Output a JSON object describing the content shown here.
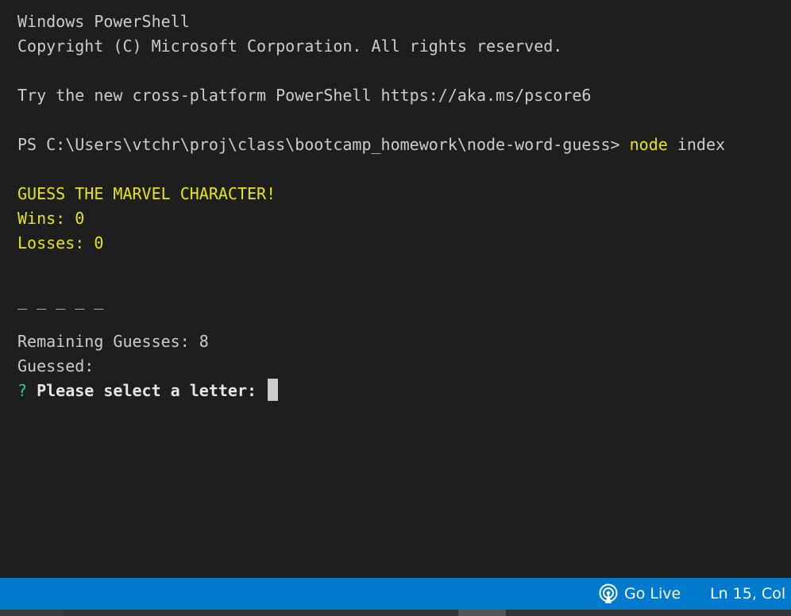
{
  "terminal": {
    "header_title": "Windows PowerShell",
    "copyright": "Copyright (C) Microsoft Corporation. All rights reserved.",
    "try_new": "Try the new cross-platform PowerShell https://aka.ms/pscore6",
    "prompt_path": "PS C:\\Users\\vtchr\\proj\\class\\bootcamp_homework\\node-word-guess> ",
    "command_name": "node",
    "command_arg": " index",
    "game_title": "GUESS THE MARVEL CHARACTER!",
    "wins": "Wins: 0",
    "losses": "Losses: 0",
    "word_blanks": "_ _ _ _ _",
    "remaining": "Remaining Guesses: 8",
    "guessed": "Guessed:",
    "question_mark": "?",
    "question_text": "Please select a letter:"
  },
  "statusbar": {
    "go_live_label": "Go Live",
    "go_live_icon": "broadcast-icon",
    "ln_col": "Ln 15, Col"
  },
  "colors": {
    "terminal_bg": "#1e1e1e",
    "terminal_text": "#cccccc",
    "yellow": "#e5e510",
    "green": "#23d18b",
    "statusbar_bg": "#007acc"
  }
}
